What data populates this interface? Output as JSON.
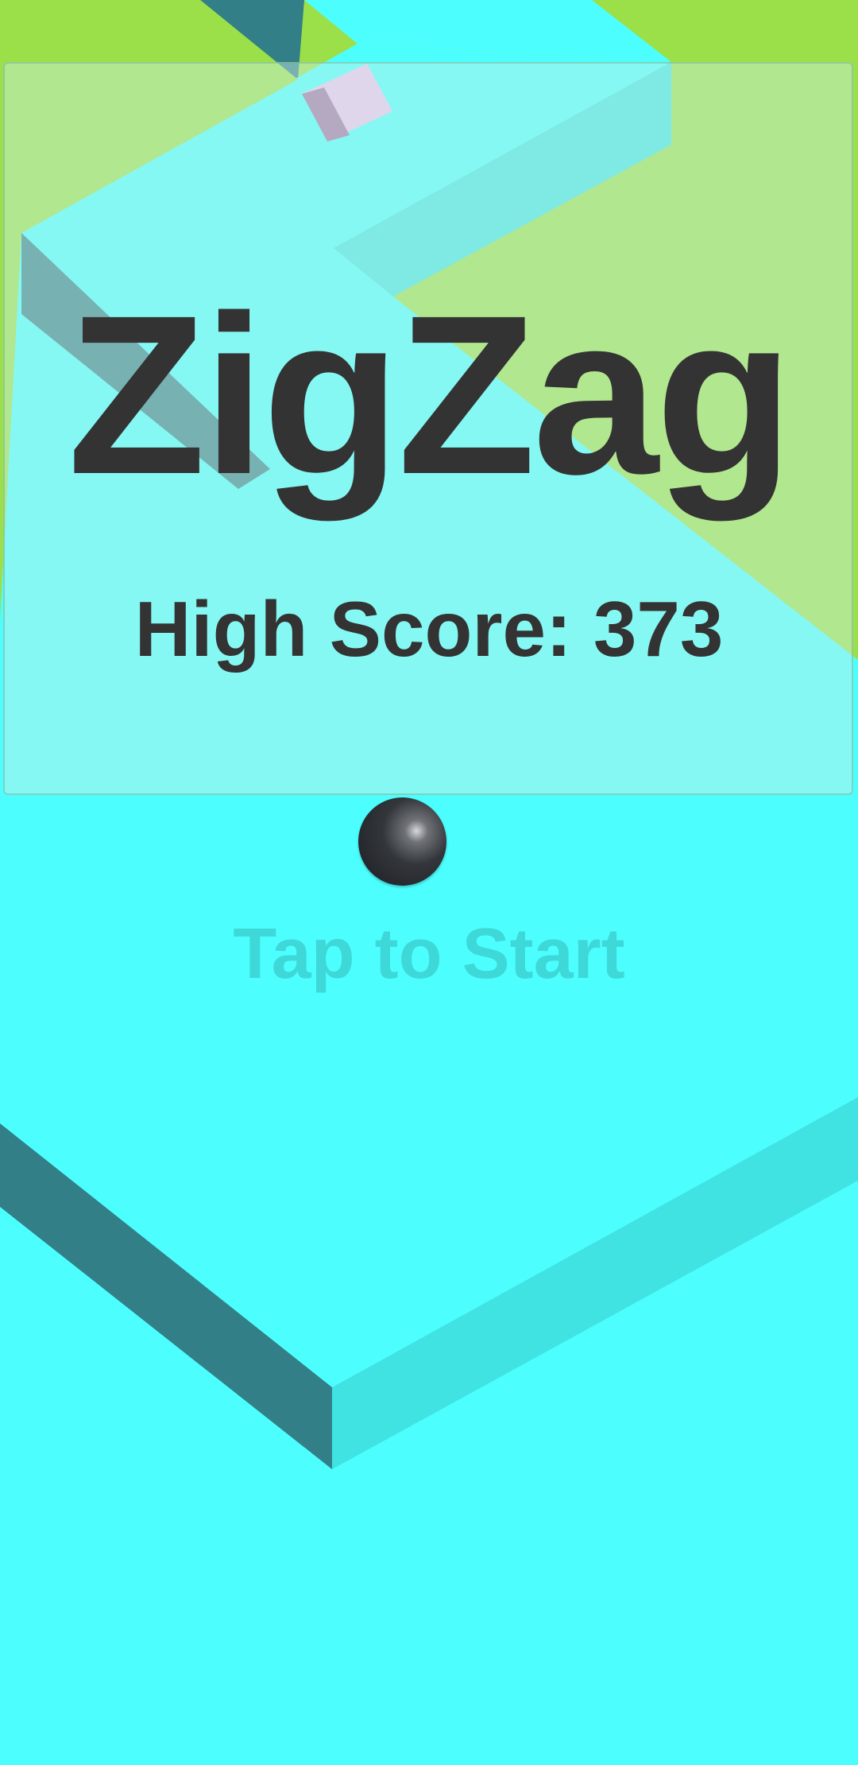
{
  "game": {
    "title": "ZigZag",
    "high_score_text": "High Score: 373",
    "start_prompt": "Tap to Start"
  },
  "colors": {
    "background": "#9be048",
    "path_top": "#4cfffe",
    "path_side_left": "#337f88",
    "path_side_right": "#40e3e2",
    "gem": "#f0c2ef",
    "ball": "#24272c",
    "text": "#333333",
    "prompt": "#3ed8d8"
  }
}
